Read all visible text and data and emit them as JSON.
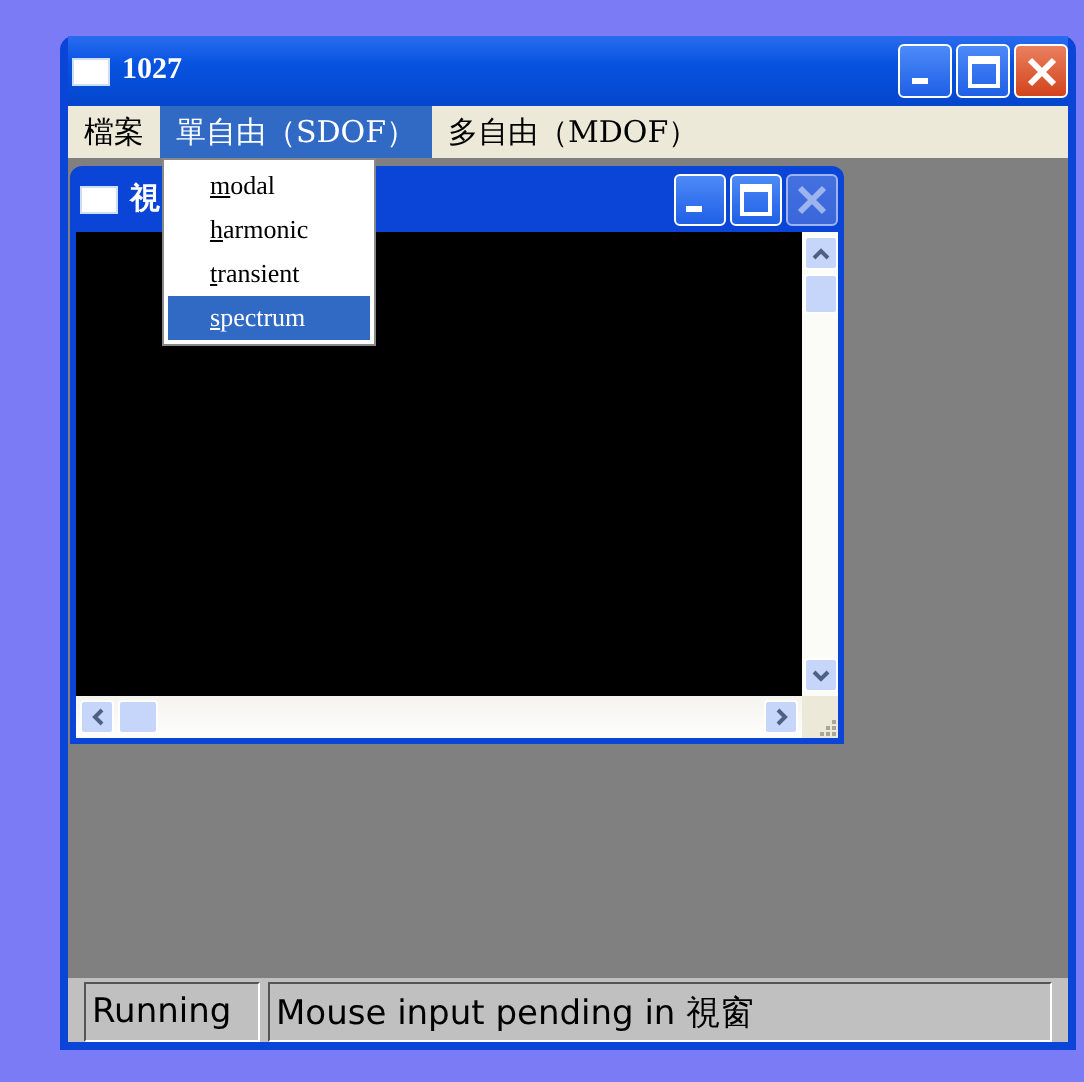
{
  "window": {
    "title": "1027"
  },
  "menu": [
    {
      "label": "檔案",
      "selected": false
    },
    {
      "label": "單自由（SDOF）",
      "selected": true
    },
    {
      "label": "多自由（MDOF）",
      "selected": false
    }
  ],
  "dropdown": [
    {
      "label": "modal",
      "selected": false
    },
    {
      "label": "harmonic",
      "selected": false
    },
    {
      "label": "transient",
      "selected": false
    },
    {
      "label": "spectrum",
      "selected": true
    }
  ],
  "child_window": {
    "title": "視",
    "close_disabled": true
  },
  "status_bar": [
    "Running",
    "Mouse input pending in 視窗"
  ]
}
